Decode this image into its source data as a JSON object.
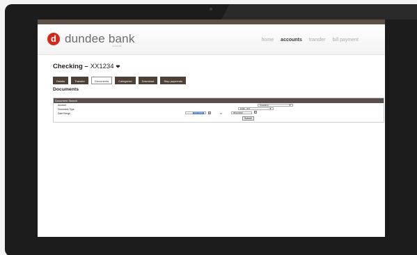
{
  "brand": {
    "logo_letter": "d",
    "name": "dundee bank",
    "tagline": "member fdic"
  },
  "nav": {
    "items": [
      "home",
      "accounts",
      "transfer",
      "bill payment"
    ],
    "active": "accounts"
  },
  "account": {
    "name": "Checking –",
    "number": "XX1234"
  },
  "tabs": [
    "Details",
    "Transfer",
    "Documents",
    "Categorize",
    "Download",
    "Stop payments"
  ],
  "selected_tab": "Documents",
  "page_title": "Documents",
  "search": {
    "header": "Document Search",
    "account_label": "Account",
    "account_value": "Checking",
    "doc_type_label": "Document Type",
    "doc_type_value": "1099 - INT",
    "date_range_label": "Date Range",
    "date_from": "04/11/2020",
    "to_label": "To",
    "date_to": "05/11/2020",
    "submit_label": "Submit"
  },
  "colors": {
    "brand_red": "#d5281b",
    "tab_brown": "#4d4035",
    "header_band": "#57504a"
  }
}
